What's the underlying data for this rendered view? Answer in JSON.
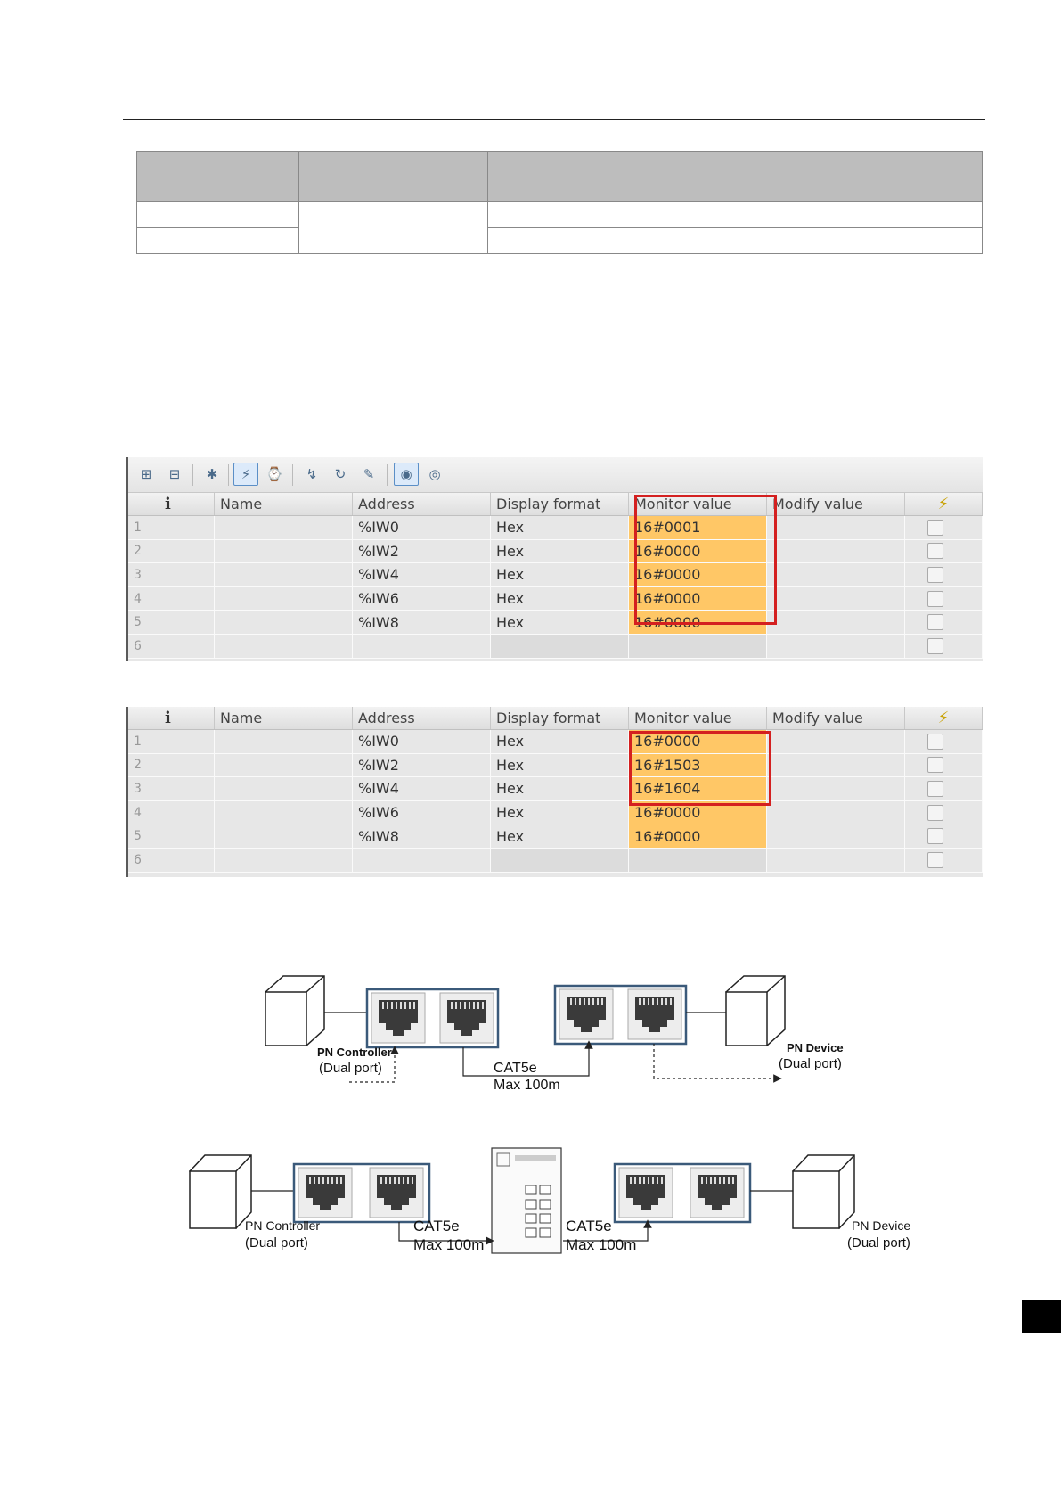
{
  "watch_table_1": {
    "headers": {
      "info": "i",
      "name": "Name",
      "address": "Address",
      "display_format": "Display format",
      "monitor_value": "Monitor value",
      "modify_value": "Modify value"
    },
    "rows": [
      {
        "num": "1",
        "address": "%IW0",
        "format": "Hex",
        "monitor": "16#0001"
      },
      {
        "num": "2",
        "address": "%IW2",
        "format": "Hex",
        "monitor": "16#0000"
      },
      {
        "num": "3",
        "address": "%IW4",
        "format": "Hex",
        "monitor": "16#0000"
      },
      {
        "num": "4",
        "address": "%IW6",
        "format": "Hex",
        "monitor": "16#0000"
      },
      {
        "num": "5",
        "address": "%IW8",
        "format": "Hex",
        "monitor": "16#0000"
      },
      {
        "num": "6",
        "address": "",
        "format": "",
        "monitor": ""
      }
    ]
  },
  "watch_table_2": {
    "headers": {
      "info": "i",
      "name": "Name",
      "address": "Address",
      "display_format": "Display format",
      "monitor_value": "Monitor value",
      "modify_value": "Modify value"
    },
    "rows": [
      {
        "num": "1",
        "address": "%IW0",
        "format": "Hex",
        "monitor": "16#0000"
      },
      {
        "num": "2",
        "address": "%IW2",
        "format": "Hex",
        "monitor": "16#1503"
      },
      {
        "num": "3",
        "address": "%IW4",
        "format": "Hex",
        "monitor": "16#1604"
      },
      {
        "num": "4",
        "address": "%IW6",
        "format": "Hex",
        "monitor": "16#0000"
      },
      {
        "num": "5",
        "address": "%IW8",
        "format": "Hex",
        "monitor": "16#0000"
      },
      {
        "num": "6",
        "address": "",
        "format": "",
        "monitor": ""
      }
    ]
  },
  "diagram_1": {
    "controller_label": "PN Controller",
    "controller_port": "(Dual port)",
    "cable": "CAT5e",
    "max_length": "Max 100m",
    "device_label": "PN Device",
    "device_port": "(Dual port)"
  },
  "diagram_2": {
    "controller_label": "PN Controller",
    "controller_port": "(Dual port)",
    "cable_left": "CAT5e",
    "max_left": "Max 100m",
    "cable_right": "CAT5e",
    "max_right": "Max 100m",
    "device_label": "PN Device",
    "device_port": "(Dual port)"
  },
  "colors": {
    "monitor_fill": "#ffc766",
    "highlight_border": "#d42020",
    "header_gray": "#bdbdbd"
  },
  "icons": [
    "add-row-icon",
    "insert-row-icon",
    "insert-modify-icon",
    "monitor-all-icon",
    "monitor-once-icon",
    "modify-now-icon",
    "modify-trigger-icon",
    "force-icon",
    "show-monitor-icon",
    "show-modify-icon",
    "info-icon",
    "force-bolt-icon"
  ]
}
